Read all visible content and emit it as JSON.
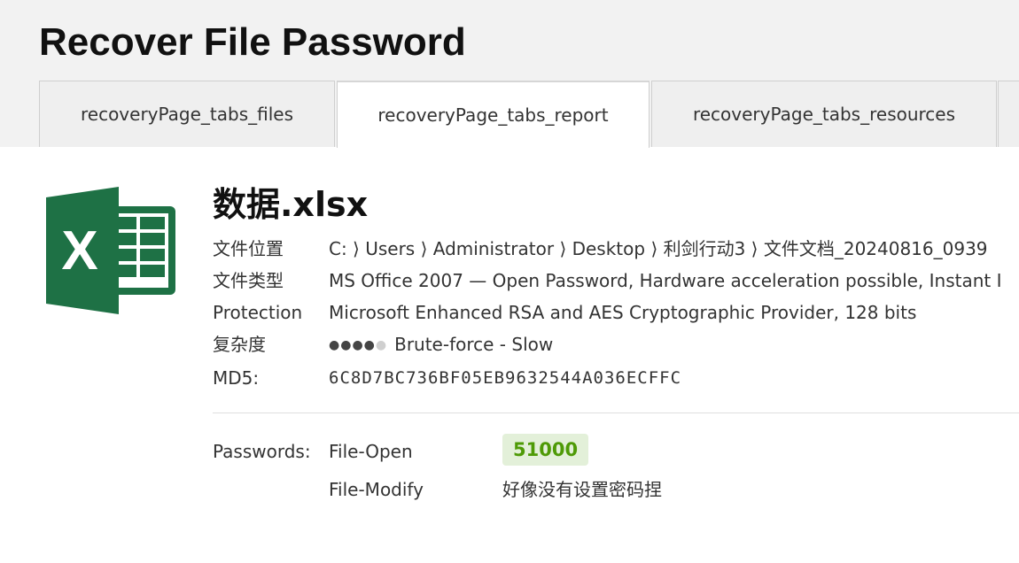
{
  "page": {
    "title": "Recover File Password"
  },
  "tabs": [
    {
      "label": "recoveryPage_tabs_files"
    },
    {
      "label": "recoveryPage_tabs_report"
    },
    {
      "label": "recoveryPage_tabs_resources"
    }
  ],
  "file": {
    "icon": "excel-icon",
    "name": "数据.xlsx",
    "location_label": "文件位置",
    "location_value": "C: ⟩ Users ⟩ Administrator ⟩ Desktop ⟩ 利剑行动3 ⟩ 文件文档_20240816_0939",
    "type_label": "文件类型",
    "type_value": "MS Office 2007 — Open Password, Hardware acceleration possible, Instant I",
    "protection_label": "Protection",
    "protection_value": "Microsoft Enhanced RSA and AES Cryptographic Provider, 128 bits",
    "complexity_label": "复杂度",
    "complexity_level": 4,
    "complexity_max": 5,
    "complexity_text": "Brute-force - Slow",
    "md5_label": "MD5:",
    "md5_value": "6C8D7BC736BF05EB9632544A036ECFFC"
  },
  "passwords": {
    "label": "Passwords:",
    "open_type": "File-Open",
    "open_value": "51000",
    "modify_type": "File-Modify",
    "modify_value": "好像没有设置密码捏"
  },
  "colors": {
    "excel_green": "#1e7145",
    "badge_bg": "#e3f0d9",
    "badge_text": "#4e9a06"
  }
}
